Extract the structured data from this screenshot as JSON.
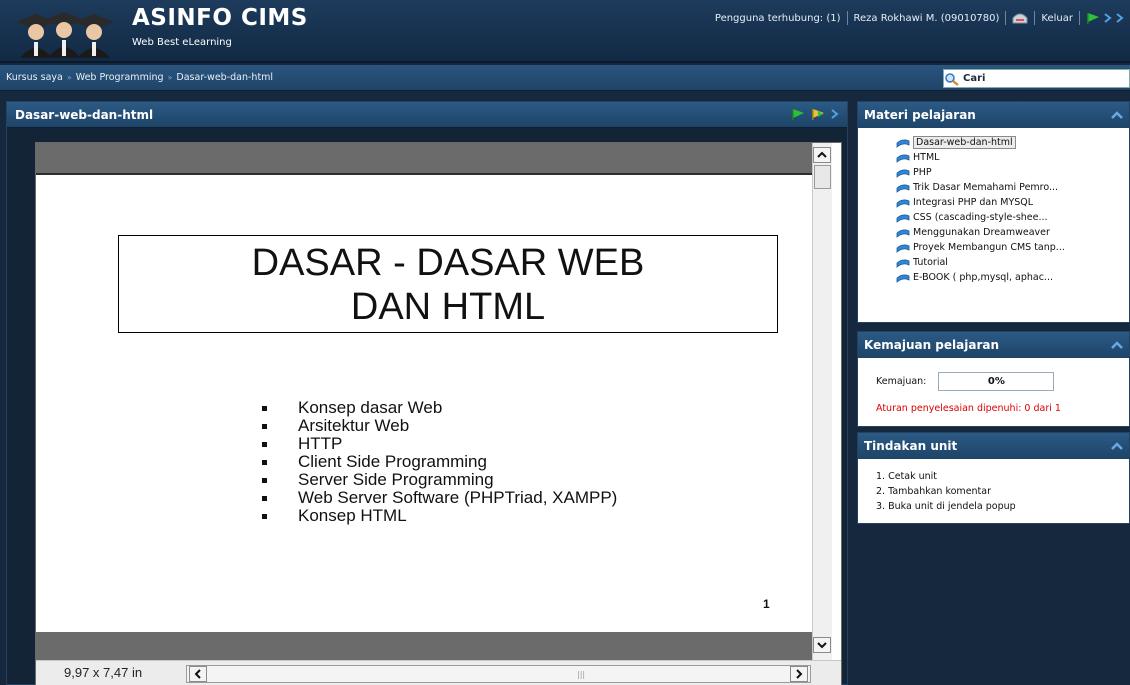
{
  "header": {
    "app_title": "ASINFO CIMS",
    "app_subtitle": "Web Best eLearning",
    "connected_users": "Pengguna terhubung: (1)",
    "user_name": "Reza Rokhawi M. (09010780)",
    "logout": "Keluar"
  },
  "breadcrumb": [
    "Kursus saya",
    "Web Programming",
    "Dasar-web-dan-html"
  ],
  "search": {
    "label": "Cari"
  },
  "main": {
    "title": "Dasar-web-dan-html",
    "viewer": {
      "slide_title": [
        "DASAR - DASAR WEB",
        "DAN HTML"
      ],
      "bullets": [
        "Konsep dasar Web",
        "Arsitektur Web",
        "HTTP",
        "Client Side Programming",
        "Server Side Programming",
        "Web Server Software (PHPTriad, XAMPP)",
        "Konsep HTML"
      ],
      "slide_number": "1",
      "page_size": "9,97 x 7,47 in"
    }
  },
  "sidebar": {
    "materi": {
      "title": "Materi pelajaran",
      "items": [
        "Dasar-web-dan-html",
        "HTML",
        "PHP",
        "Trik Dasar Memahami Pemro...",
        "Integrasi PHP dan MYSQL",
        "CSS (cascading-style-shee...",
        "Menggunakan Dreamweaver",
        "Proyek Membangun CMS tanp...",
        "Tutorial",
        "E-BOOK ( php,mysql, aphac..."
      ],
      "active_index": 0
    },
    "kemajuan": {
      "title": "Kemajuan pelajaran",
      "label": "Kemajuan:",
      "value": "0%",
      "percent": 0,
      "rule": "Aturan penyelesaian dipenuhi: 0 dari 1"
    },
    "tindakan": {
      "title": "Tindakan unit",
      "items": [
        "1. Cetak unit",
        "2. Tambahkan komentar",
        "3. Buka unit di jendela popup"
      ]
    }
  },
  "colors": {
    "accent_blue": "#2b5a85",
    "rule_red": "#dd0000",
    "progress_fill": "#6a9ed1"
  }
}
